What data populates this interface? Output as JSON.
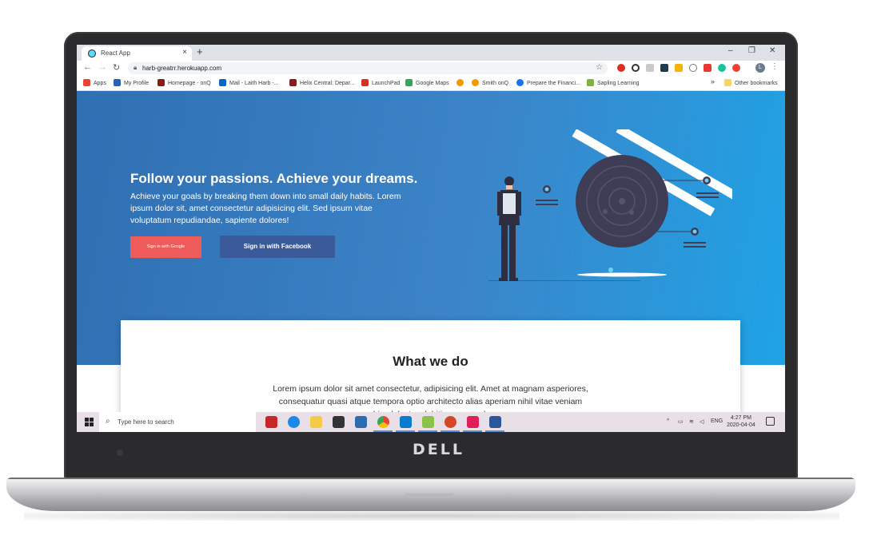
{
  "laptop": {
    "brand": "DELL"
  },
  "browser": {
    "tab_title": "React App",
    "new_tab": "+",
    "window_controls": {
      "minimize": "–",
      "restore": "❐",
      "close": "✕"
    },
    "url": "harb-greatrr.herokuapp.com",
    "profile_initial": "L",
    "bookmarks": [
      {
        "label": "Apps",
        "color": "#ea4335"
      },
      {
        "label": "My Profile",
        "color": "#2b5fb4"
      },
      {
        "label": "Homepage - onQ",
        "color": "#8b1a1a"
      },
      {
        "label": "Mail - Laith Harb -...",
        "color": "#0a66c2"
      },
      {
        "label": "Helix Central: Depar...",
        "color": "#8b1a1a"
      },
      {
        "label": "LaunchPad",
        "color": "#d93025"
      },
      {
        "label": "Google Maps",
        "color": "#34a853"
      },
      {
        "label": "",
        "color": "#f29900"
      },
      {
        "label": "Smith onQ",
        "color": "#f29900"
      },
      {
        "label": "Prepare the Financi...",
        "color": "#1a73e8"
      },
      {
        "label": "Sapling Learning",
        "color": "#7cb342"
      }
    ],
    "bookmarks_more": "»",
    "other_bookmarks": "Other bookmarks"
  },
  "hero": {
    "title": "Follow your passions. Achieve your dreams.",
    "text": "Achieve your goals by breaking them down into small daily habits. Lorem ipsum dolor sit, amet consectetur adipisicing elit. Sed ipsum vitae voluptatum repudiandae, sapiente dolores!",
    "google_button": "Sign in with Google",
    "facebook_button": "Sign in with Facebook"
  },
  "section": {
    "title": "What we do",
    "text": "Lorem ipsum dolor sit amet consectetur, adipisicing elit. Amet at magnam asperiores, consequatur quasi atque tempora optio architecto alias aperiam nihil vitae veniam nobis, delectus debitis, recusandae."
  },
  "taskbar": {
    "search_placeholder": "Type here to search",
    "language": "ENG",
    "time": "4:27 PM",
    "date": "2020-04-04"
  },
  "colors": {
    "hero_start": "#2f6fb2",
    "hero_end": "#1fa3e6",
    "google_button": "#ef5b5b",
    "facebook_button": "#3b5a9a",
    "illustration_dark": "#3f3d56"
  }
}
